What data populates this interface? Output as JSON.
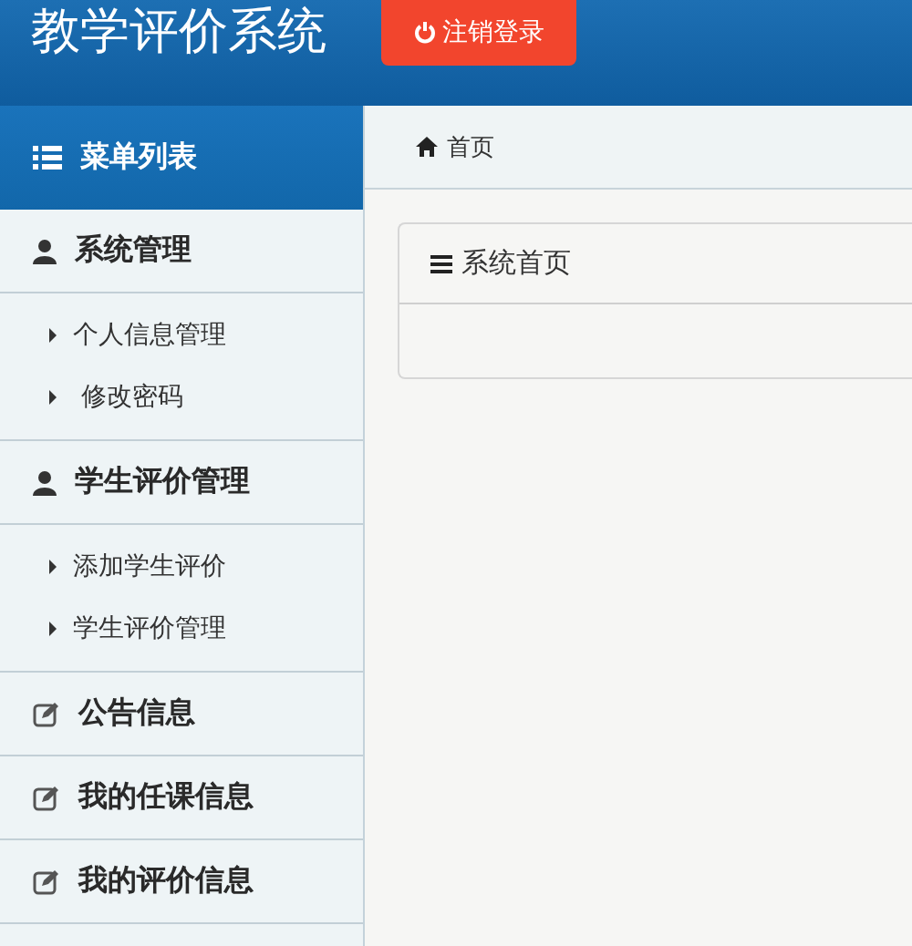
{
  "header": {
    "title": "教学评价系统",
    "logout_button": "注销登录"
  },
  "sidebar": {
    "title": "菜单列表",
    "sections": [
      {
        "label": "系统管理",
        "kind": "user",
        "children": [
          {
            "label": "个人信息管理"
          },
          {
            "label": " 修改密码"
          }
        ]
      },
      {
        "label": "学生评价管理",
        "kind": "user",
        "children": [
          {
            "label": "添加学生评价"
          },
          {
            "label": "学生评价管理"
          }
        ]
      },
      {
        "label": "公告信息",
        "kind": "edit"
      },
      {
        "label": "我的任课信息",
        "kind": "edit"
      },
      {
        "label": "我的评价信息",
        "kind": "edit"
      }
    ]
  },
  "breadcrumb": {
    "label": "首页"
  },
  "panel": {
    "title": "系统首页"
  }
}
